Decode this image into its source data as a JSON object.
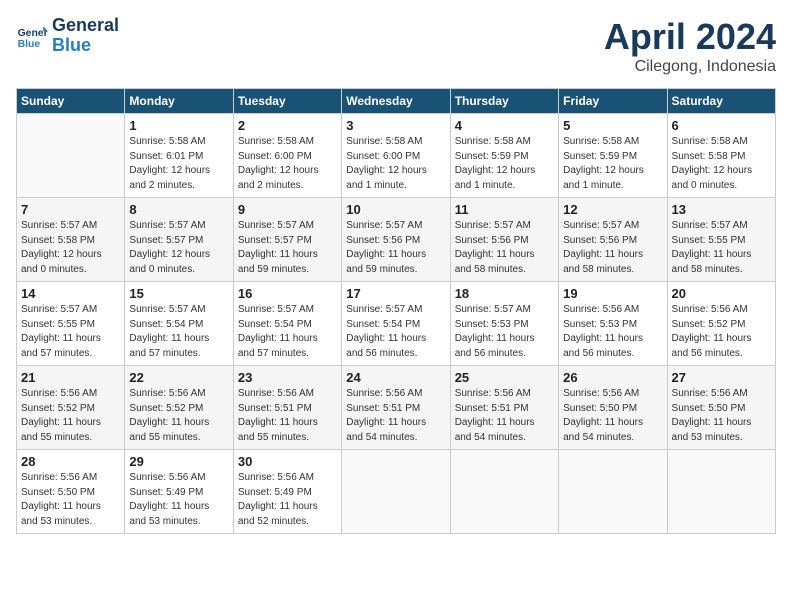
{
  "header": {
    "logo_line1": "General",
    "logo_line2": "Blue",
    "month": "April 2024",
    "location": "Cilegong, Indonesia"
  },
  "days_of_week": [
    "Sunday",
    "Monday",
    "Tuesday",
    "Wednesday",
    "Thursday",
    "Friday",
    "Saturday"
  ],
  "weeks": [
    [
      {
        "day": "",
        "info": ""
      },
      {
        "day": "1",
        "info": "Sunrise: 5:58 AM\nSunset: 6:01 PM\nDaylight: 12 hours\nand 2 minutes."
      },
      {
        "day": "2",
        "info": "Sunrise: 5:58 AM\nSunset: 6:00 PM\nDaylight: 12 hours\nand 2 minutes."
      },
      {
        "day": "3",
        "info": "Sunrise: 5:58 AM\nSunset: 6:00 PM\nDaylight: 12 hours\nand 1 minute."
      },
      {
        "day": "4",
        "info": "Sunrise: 5:58 AM\nSunset: 5:59 PM\nDaylight: 12 hours\nand 1 minute."
      },
      {
        "day": "5",
        "info": "Sunrise: 5:58 AM\nSunset: 5:59 PM\nDaylight: 12 hours\nand 1 minute."
      },
      {
        "day": "6",
        "info": "Sunrise: 5:58 AM\nSunset: 5:58 PM\nDaylight: 12 hours\nand 0 minutes."
      }
    ],
    [
      {
        "day": "7",
        "info": "Sunrise: 5:57 AM\nSunset: 5:58 PM\nDaylight: 12 hours\nand 0 minutes."
      },
      {
        "day": "8",
        "info": "Sunrise: 5:57 AM\nSunset: 5:57 PM\nDaylight: 12 hours\nand 0 minutes."
      },
      {
        "day": "9",
        "info": "Sunrise: 5:57 AM\nSunset: 5:57 PM\nDaylight: 11 hours\nand 59 minutes."
      },
      {
        "day": "10",
        "info": "Sunrise: 5:57 AM\nSunset: 5:56 PM\nDaylight: 11 hours\nand 59 minutes."
      },
      {
        "day": "11",
        "info": "Sunrise: 5:57 AM\nSunset: 5:56 PM\nDaylight: 11 hours\nand 58 minutes."
      },
      {
        "day": "12",
        "info": "Sunrise: 5:57 AM\nSunset: 5:56 PM\nDaylight: 11 hours\nand 58 minutes."
      },
      {
        "day": "13",
        "info": "Sunrise: 5:57 AM\nSunset: 5:55 PM\nDaylight: 11 hours\nand 58 minutes."
      }
    ],
    [
      {
        "day": "14",
        "info": "Sunrise: 5:57 AM\nSunset: 5:55 PM\nDaylight: 11 hours\nand 57 minutes."
      },
      {
        "day": "15",
        "info": "Sunrise: 5:57 AM\nSunset: 5:54 PM\nDaylight: 11 hours\nand 57 minutes."
      },
      {
        "day": "16",
        "info": "Sunrise: 5:57 AM\nSunset: 5:54 PM\nDaylight: 11 hours\nand 57 minutes."
      },
      {
        "day": "17",
        "info": "Sunrise: 5:57 AM\nSunset: 5:54 PM\nDaylight: 11 hours\nand 56 minutes."
      },
      {
        "day": "18",
        "info": "Sunrise: 5:57 AM\nSunset: 5:53 PM\nDaylight: 11 hours\nand 56 minutes."
      },
      {
        "day": "19",
        "info": "Sunrise: 5:56 AM\nSunset: 5:53 PM\nDaylight: 11 hours\nand 56 minutes."
      },
      {
        "day": "20",
        "info": "Sunrise: 5:56 AM\nSunset: 5:52 PM\nDaylight: 11 hours\nand 56 minutes."
      }
    ],
    [
      {
        "day": "21",
        "info": "Sunrise: 5:56 AM\nSunset: 5:52 PM\nDaylight: 11 hours\nand 55 minutes."
      },
      {
        "day": "22",
        "info": "Sunrise: 5:56 AM\nSunset: 5:52 PM\nDaylight: 11 hours\nand 55 minutes."
      },
      {
        "day": "23",
        "info": "Sunrise: 5:56 AM\nSunset: 5:51 PM\nDaylight: 11 hours\nand 55 minutes."
      },
      {
        "day": "24",
        "info": "Sunrise: 5:56 AM\nSunset: 5:51 PM\nDaylight: 11 hours\nand 54 minutes."
      },
      {
        "day": "25",
        "info": "Sunrise: 5:56 AM\nSunset: 5:51 PM\nDaylight: 11 hours\nand 54 minutes."
      },
      {
        "day": "26",
        "info": "Sunrise: 5:56 AM\nSunset: 5:50 PM\nDaylight: 11 hours\nand 54 minutes."
      },
      {
        "day": "27",
        "info": "Sunrise: 5:56 AM\nSunset: 5:50 PM\nDaylight: 11 hours\nand 53 minutes."
      }
    ],
    [
      {
        "day": "28",
        "info": "Sunrise: 5:56 AM\nSunset: 5:50 PM\nDaylight: 11 hours\nand 53 minutes."
      },
      {
        "day": "29",
        "info": "Sunrise: 5:56 AM\nSunset: 5:49 PM\nDaylight: 11 hours\nand 53 minutes."
      },
      {
        "day": "30",
        "info": "Sunrise: 5:56 AM\nSunset: 5:49 PM\nDaylight: 11 hours\nand 52 minutes."
      },
      {
        "day": "",
        "info": ""
      },
      {
        "day": "",
        "info": ""
      },
      {
        "day": "",
        "info": ""
      },
      {
        "day": "",
        "info": ""
      }
    ]
  ]
}
